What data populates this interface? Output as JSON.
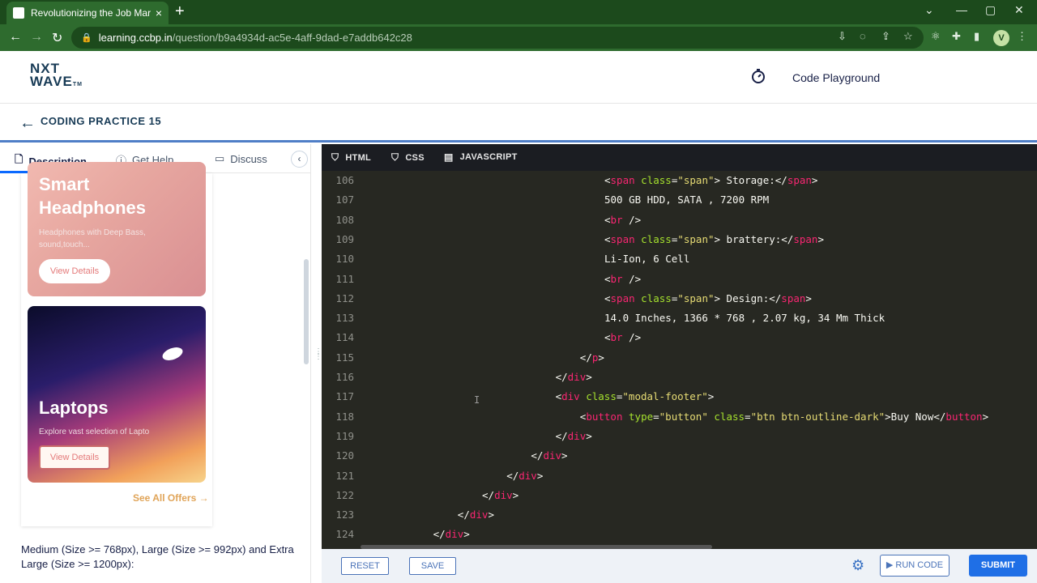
{
  "browser": {
    "tab_title": "Revolutionizing the Job Market |",
    "url_host": "learning.ccbp.in",
    "url_path": "/question/b9a4934d-ac5e-4aff-9dad-e7addb642c28",
    "profile_initial": "V"
  },
  "header": {
    "logo_line1": "NXT",
    "logo_line2": "WAVE",
    "logo_tm": "TM",
    "playground_label": "Code Playground"
  },
  "practice": {
    "title": "CODING PRACTICE 15"
  },
  "left_tabs": {
    "description": "Description",
    "get_help": "Get Help",
    "discuss": "Discuss"
  },
  "preview": {
    "card1": {
      "title_line1": "Smart",
      "title_line2": "Headphones",
      "subtitle_line1": "Headphones with Deep Bass,",
      "subtitle_line2": "sound,touch...",
      "button": "View Details"
    },
    "card2": {
      "title": "Laptops",
      "subtitle": "Explore vast selection of Lapto",
      "button": "View Details"
    },
    "see_all": "See All Offers →"
  },
  "description_text": "Medium (Size >= 768px), Large (Size >= 992px) and Extra Large (Size >= 1200px):",
  "editor_tabs": {
    "html": "HTML",
    "css": "CSS",
    "js": "JAVASCRIPT"
  },
  "code_lines": [
    {
      "n": "106",
      "indent": 10,
      "parts": [
        [
          "p",
          "<"
        ],
        [
          "tg",
          "span"
        ],
        [
          "p",
          " "
        ],
        [
          "at",
          "class"
        ],
        [
          "p",
          "="
        ],
        [
          "st",
          "\"span\""
        ],
        [
          "p",
          "> Storage:</"
        ],
        [
          "tg",
          "span"
        ],
        [
          "p",
          ">"
        ]
      ]
    },
    {
      "n": "107",
      "indent": 10,
      "parts": [
        [
          "p",
          "500 GB HDD, SATA , 7200 RPM"
        ]
      ]
    },
    {
      "n": "108",
      "indent": 10,
      "parts": [
        [
          "p",
          "<"
        ],
        [
          "tg",
          "br"
        ],
        [
          "p",
          " />"
        ]
      ]
    },
    {
      "n": "109",
      "indent": 10,
      "parts": [
        [
          "p",
          "<"
        ],
        [
          "tg",
          "span"
        ],
        [
          "p",
          " "
        ],
        [
          "at",
          "class"
        ],
        [
          "p",
          "="
        ],
        [
          "st",
          "\"span\""
        ],
        [
          "p",
          "> brattery:</"
        ],
        [
          "tg",
          "span"
        ],
        [
          "p",
          ">"
        ]
      ]
    },
    {
      "n": "110",
      "indent": 10,
      "parts": [
        [
          "p",
          "Li-Ion, 6 Cell"
        ]
      ]
    },
    {
      "n": "111",
      "indent": 10,
      "parts": [
        [
          "p",
          "<"
        ],
        [
          "tg",
          "br"
        ],
        [
          "p",
          " />"
        ]
      ]
    },
    {
      "n": "112",
      "indent": 10,
      "parts": [
        [
          "p",
          "<"
        ],
        [
          "tg",
          "span"
        ],
        [
          "p",
          " "
        ],
        [
          "at",
          "class"
        ],
        [
          "p",
          "="
        ],
        [
          "st",
          "\"span\""
        ],
        [
          "p",
          "> Design:</"
        ],
        [
          "tg",
          "span"
        ],
        [
          "p",
          ">"
        ]
      ]
    },
    {
      "n": "113",
      "indent": 10,
      "parts": [
        [
          "p",
          "14.0 Inches, 1366 * 768 , 2.07 kg, 34 Mm Thick"
        ]
      ]
    },
    {
      "n": "114",
      "indent": 10,
      "parts": [
        [
          "p",
          "<"
        ],
        [
          "tg",
          "br"
        ],
        [
          "p",
          " />"
        ]
      ]
    },
    {
      "n": "115",
      "indent": 9,
      "parts": [
        [
          "p",
          "</"
        ],
        [
          "tg",
          "p"
        ],
        [
          "p",
          ">"
        ]
      ]
    },
    {
      "n": "116",
      "indent": 8,
      "parts": [
        [
          "p",
          "</"
        ],
        [
          "tg",
          "div"
        ],
        [
          "p",
          ">"
        ]
      ]
    },
    {
      "n": "117",
      "indent": 8,
      "parts": [
        [
          "p",
          "<"
        ],
        [
          "tg",
          "div"
        ],
        [
          "p",
          " "
        ],
        [
          "at",
          "class"
        ],
        [
          "p",
          "="
        ],
        [
          "st",
          "\"modal-footer\""
        ],
        [
          "p",
          ">"
        ]
      ]
    },
    {
      "n": "118",
      "indent": 9,
      "parts": [
        [
          "p",
          "<"
        ],
        [
          "tg",
          "button"
        ],
        [
          "p",
          " "
        ],
        [
          "at",
          "type"
        ],
        [
          "p",
          "="
        ],
        [
          "st",
          "\"button\""
        ],
        [
          "p",
          " "
        ],
        [
          "at",
          "class"
        ],
        [
          "p",
          "="
        ],
        [
          "st",
          "\"btn btn-outline-dark\""
        ],
        [
          "p",
          ">Buy Now</"
        ],
        [
          "tg",
          "button"
        ],
        [
          "p",
          ">"
        ]
      ]
    },
    {
      "n": "119",
      "indent": 8,
      "parts": [
        [
          "p",
          "</"
        ],
        [
          "tg",
          "div"
        ],
        [
          "p",
          ">"
        ]
      ]
    },
    {
      "n": "120",
      "indent": 7,
      "parts": [
        [
          "p",
          "</"
        ],
        [
          "tg",
          "div"
        ],
        [
          "p",
          ">"
        ]
      ]
    },
    {
      "n": "121",
      "indent": 6,
      "parts": [
        [
          "p",
          "</"
        ],
        [
          "tg",
          "div"
        ],
        [
          "p",
          ">"
        ]
      ]
    },
    {
      "n": "122",
      "indent": 5,
      "parts": [
        [
          "p",
          "</"
        ],
        [
          "tg",
          "div"
        ],
        [
          "p",
          ">"
        ]
      ]
    },
    {
      "n": "123",
      "indent": 4,
      "parts": [
        [
          "p",
          "</"
        ],
        [
          "tg",
          "div"
        ],
        [
          "p",
          ">"
        ]
      ]
    },
    {
      "n": "124",
      "indent": 3,
      "parts": [
        [
          "p",
          "</"
        ],
        [
          "tg",
          "div"
        ],
        [
          "p",
          ">"
        ]
      ]
    }
  ],
  "bottom": {
    "reset": "RESET",
    "save": "SAVE",
    "run": "▶ RUN CODE",
    "submit": "SUBMIT"
  },
  "colors": {
    "accent": "#1f6fe6",
    "browser_green": "#2e6b2e",
    "editor_bg": "#272822",
    "tag": "#f92672",
    "attr": "#a6e22e",
    "string": "#e6db74"
  }
}
